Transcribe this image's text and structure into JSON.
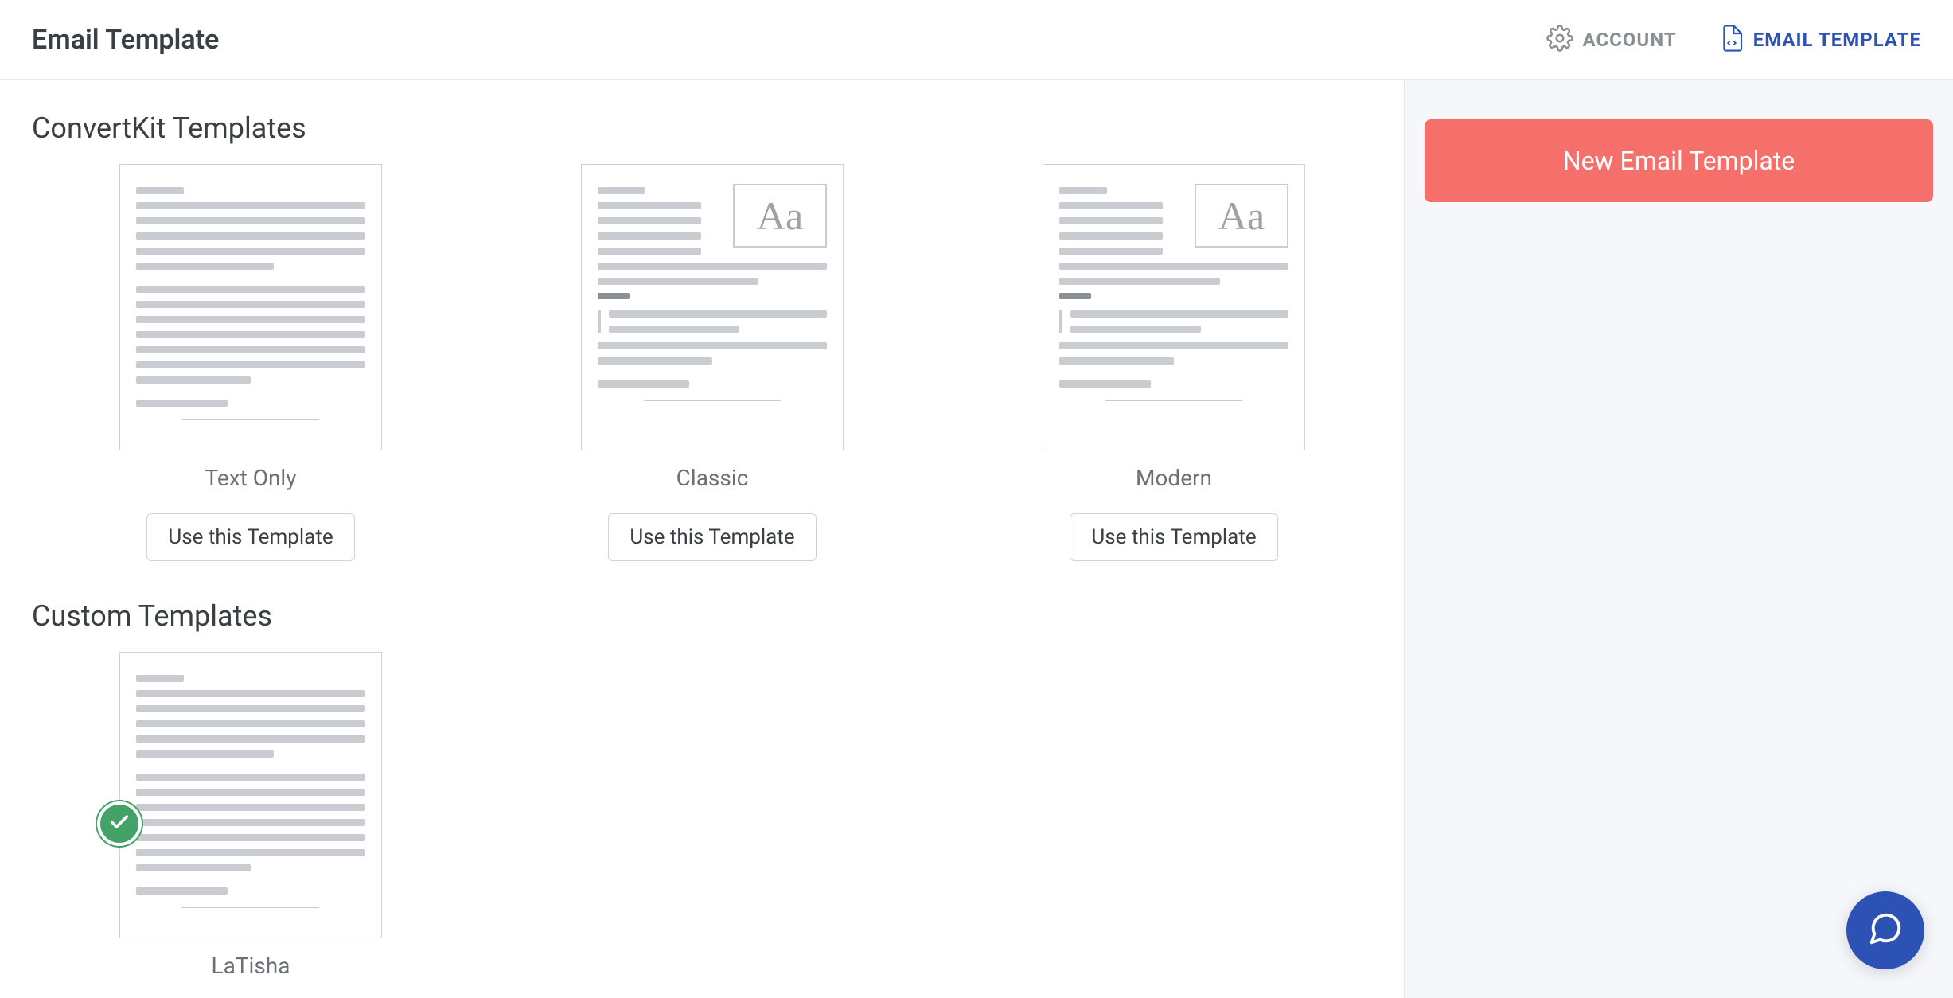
{
  "header": {
    "title": "Email Template",
    "nav": {
      "account_label": "ACCOUNT",
      "email_template_label": "EMAIL TEMPLATE"
    }
  },
  "sections": {
    "convertkit_title": "ConvertKit Templates",
    "custom_title": "Custom Templates"
  },
  "templates": {
    "convertkit": [
      {
        "name": "Text Only",
        "use_label": "Use this Template"
      },
      {
        "name": "Classic",
        "use_label": "Use this Template"
      },
      {
        "name": "Modern",
        "use_label": "Use this Template"
      }
    ],
    "custom": [
      {
        "name": "LaTisha",
        "selected": true
      }
    ]
  },
  "sidebar": {
    "new_template_label": "New Email Template"
  },
  "icons": {
    "gear": "gear-icon",
    "file_code": "file-code-icon",
    "check": "check-icon",
    "chat": "chat-icon"
  }
}
